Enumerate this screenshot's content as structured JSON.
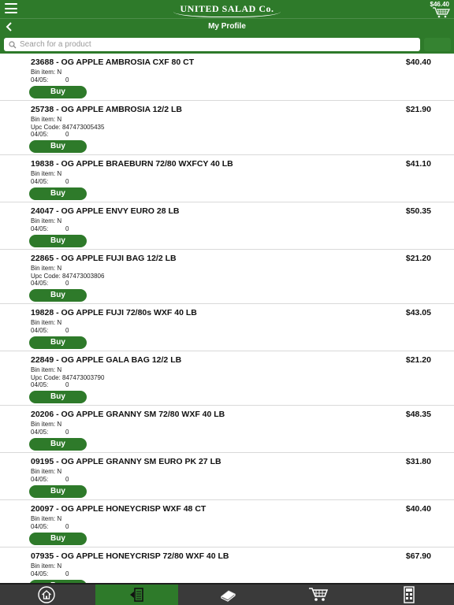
{
  "header": {
    "brand": "UNITED SALAD Co.",
    "cart_total": "$46.40",
    "title": "My Profile"
  },
  "search": {
    "placeholder": "Search for a product"
  },
  "items": [
    {
      "name": "23688 - OG APPLE AMBROSIA CXF 80 CT",
      "price": "$40.40",
      "bin_label": "Bin item:",
      "bin_value": "N",
      "date_label": "04/05:",
      "qty": "0",
      "buy": "Buy"
    },
    {
      "name": "25738 - OG APPLE AMBROSIA 12/2 LB",
      "price": "$21.90",
      "bin_label": "Bin item:",
      "bin_value": "N",
      "upc": "Upc Code: 847473005435",
      "date_label": "04/05:",
      "qty": "0",
      "buy": "Buy"
    },
    {
      "name": "19838 - OG APPLE BRAEBURN 72/80 WXFCY 40 LB",
      "price": "$41.10",
      "bin_label": "Bin item:",
      "bin_value": "N",
      "date_label": "04/05:",
      "qty": "0",
      "buy": "Buy"
    },
    {
      "name": "24047 - OG APPLE ENVY EURO 28 LB",
      "price": "$50.35",
      "bin_label": "Bin item:",
      "bin_value": "N",
      "date_label": "04/05:",
      "qty": "0",
      "buy": "Buy"
    },
    {
      "name": "22865 - OG APPLE FUJI BAG 12/2 LB",
      "price": "$21.20",
      "bin_label": "Bin item:",
      "bin_value": "N",
      "upc": "Upc Code: 847473003806",
      "date_label": "04/05:",
      "qty": "0",
      "buy": "Buy"
    },
    {
      "name": "19828 - OG APPLE FUJI 72/80s WXF 40 LB",
      "price": "$43.05",
      "bin_label": "Bin item:",
      "bin_value": "N",
      "date_label": "04/05:",
      "qty": "0",
      "buy": "Buy"
    },
    {
      "name": "22849 - OG APPLE GALA BAG 12/2 LB",
      "price": "$21.20",
      "bin_label": "Bin item:",
      "bin_value": "N",
      "upc": "Upc Code: 847473003790",
      "date_label": "04/05:",
      "qty": "0",
      "buy": "Buy"
    },
    {
      "name": "20206 - OG APPLE GRANNY SM 72/80 WXF 40 LB",
      "price": "$48.35",
      "bin_label": "Bin item:",
      "bin_value": "N",
      "date_label": "04/05:",
      "qty": "0",
      "buy": "Buy"
    },
    {
      "name": "09195 - OG APPLE GRANNY SM EURO PK 27 LB",
      "price": "$31.80",
      "bin_label": "Bin item:",
      "bin_value": "N",
      "date_label": "04/05:",
      "qty": "0",
      "buy": "Buy"
    },
    {
      "name": "20097 - OG APPLE HONEYCRISP WXF 48 CT",
      "price": "$40.40",
      "bin_label": "Bin item:",
      "bin_value": "N",
      "date_label": "04/05:",
      "qty": "0",
      "buy": "Buy"
    },
    {
      "name": "07935 - OG APPLE HONEYCRISP 72/80 WXF 40 LB",
      "price": "$67.90",
      "bin_label": "Bin item:",
      "bin_value": "N",
      "date_label": "04/05:",
      "qty": "0",
      "buy": "Buy"
    }
  ],
  "footer_tabs": [
    {
      "icon": "home-icon"
    },
    {
      "icon": "order-guide-icon",
      "active": true
    },
    {
      "icon": "catalog-book-icon"
    },
    {
      "icon": "cart-icon"
    },
    {
      "icon": "calculator-icon"
    }
  ],
  "colors": {
    "brand_green": "#2e7a2a",
    "footer_bg": "#3a3a3a"
  }
}
